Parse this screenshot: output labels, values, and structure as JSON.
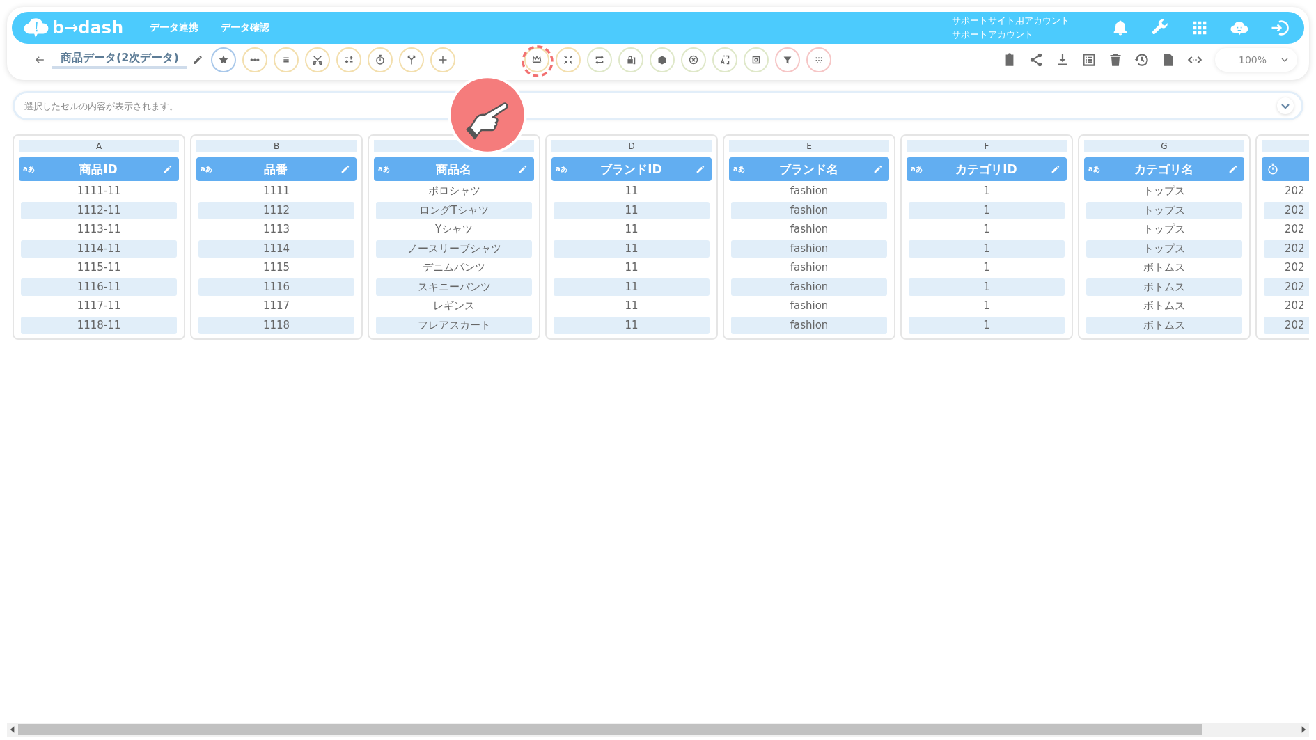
{
  "header": {
    "logo": "b→dash",
    "nav": [
      "データ連携",
      "データ確認"
    ],
    "account": {
      "site": "サポートサイト用アカウント",
      "user": "サポートアカウント"
    }
  },
  "toolbar": {
    "title": "商品データ(2次データ)",
    "zoom": "100%"
  },
  "cell_preview": {
    "placeholder": "選択したセルの内容が表示されます。"
  },
  "columns": [
    {
      "letter": "A",
      "kind": "text",
      "type_label": "aあ",
      "name": "商品ID",
      "cells": [
        "1111-11",
        "1112-11",
        "1113-11",
        "1114-11",
        "1115-11",
        "1116-11",
        "1117-11",
        "1118-11"
      ]
    },
    {
      "letter": "B",
      "kind": "text",
      "type_label": "aあ",
      "name": "品番",
      "cells": [
        "1111",
        "1112",
        "1113",
        "1114",
        "1115",
        "1116",
        "1117",
        "1118"
      ]
    },
    {
      "kind": "text",
      "type_label": "aあ",
      "name": "商品名",
      "cells": [
        "ポロシャツ",
        "ロングTシャツ",
        "Yシャツ",
        "ノースリーブシャツ",
        "デニムパンツ",
        "スキニーパンツ",
        "レギンス",
        "フレアスカート"
      ]
    },
    {
      "letter": "D",
      "kind": "text",
      "type_label": "aあ",
      "name": "ブランドID",
      "cells": [
        "11",
        "11",
        "11",
        "11",
        "11",
        "11",
        "11",
        "11"
      ]
    },
    {
      "letter": "E",
      "kind": "text",
      "type_label": "aあ",
      "name": "ブランド名",
      "cells": [
        "fashion",
        "fashion",
        "fashion",
        "fashion",
        "fashion",
        "fashion",
        "fashion",
        "fashion"
      ]
    },
    {
      "letter": "F",
      "kind": "text",
      "type_label": "aあ",
      "name": "カテゴリID",
      "cells": [
        "1",
        "1",
        "1",
        "1",
        "1",
        "1",
        "1",
        "1"
      ]
    },
    {
      "letter": "G",
      "kind": "text",
      "type_label": "aあ",
      "name": "カテゴリ名",
      "cells": [
        "トップス",
        "トップス",
        "トップス",
        "トップス",
        "ボトムス",
        "ボトムス",
        "ボトムス",
        "ボトムス"
      ]
    },
    {
      "kind": "time",
      "cells": [
        "202",
        "202",
        "202",
        "202",
        "202",
        "202",
        "202",
        "202"
      ]
    }
  ]
}
